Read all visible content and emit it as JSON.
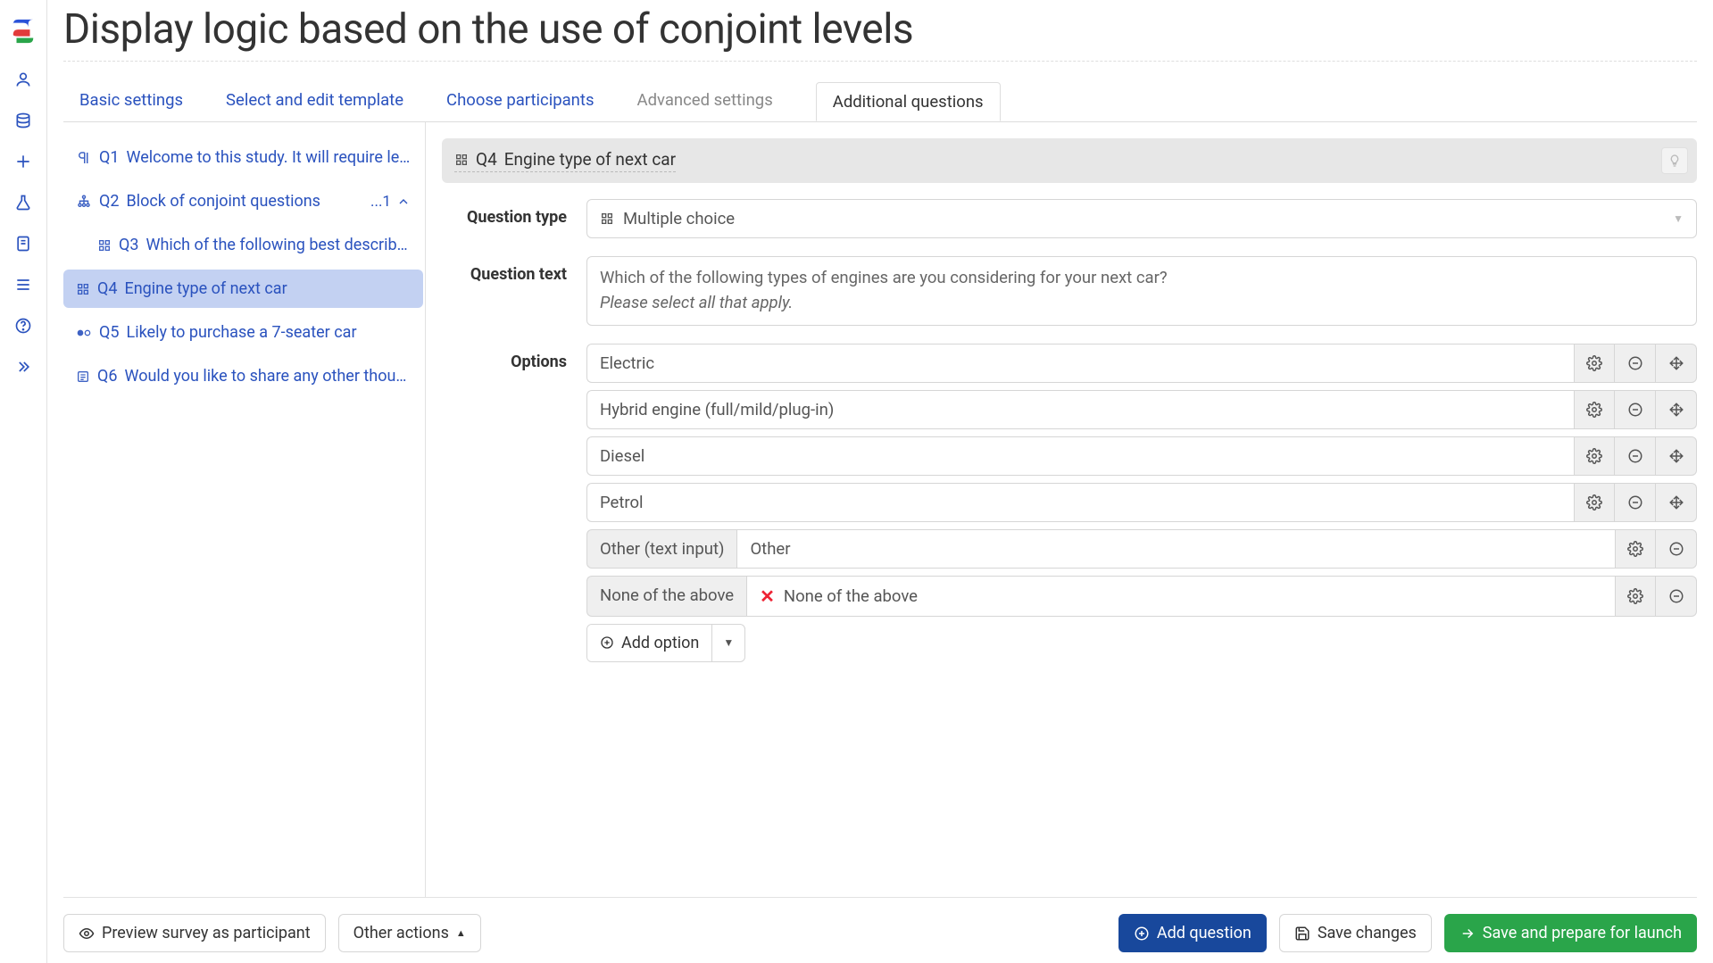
{
  "page_title": "Display logic based on the use of conjoint levels",
  "tabs": [
    {
      "label": "Basic settings",
      "state": "link"
    },
    {
      "label": "Select and edit template",
      "state": "link"
    },
    {
      "label": "Choose participants",
      "state": "link"
    },
    {
      "label": "Advanced settings",
      "state": "disabled"
    },
    {
      "label": "Additional questions",
      "state": "active"
    }
  ],
  "questions": [
    {
      "num": "Q1",
      "label": "Welcome to this study. It will require less t…",
      "icon": "paragraph",
      "child": false,
      "selected": false,
      "tail": ""
    },
    {
      "num": "Q2",
      "label": "Block of conjoint questions",
      "icon": "hierarchy",
      "child": false,
      "selected": false,
      "tail": "...1",
      "chevron": true
    },
    {
      "num": "Q3",
      "label": "Which of the following best describes …",
      "icon": "grid",
      "child": true,
      "selected": false,
      "tail": ""
    },
    {
      "num": "Q4",
      "label": "Engine type of next car",
      "icon": "grid",
      "child": false,
      "selected": true,
      "tail": ""
    },
    {
      "num": "Q5",
      "label": "Likely to purchase a 7-seater car",
      "icon": "radio",
      "child": false,
      "selected": false,
      "tail": ""
    },
    {
      "num": "Q6",
      "label": "Would you like to share any other thought…",
      "icon": "note",
      "child": false,
      "selected": false,
      "tail": ""
    }
  ],
  "current": {
    "num": "Q4",
    "title": "Engine type of next car",
    "type_label_prefix": "Question type",
    "type_value": "Multiple choice",
    "text_label": "Question text",
    "text_line1": "Which of the following types of engines are you considering for your next car?",
    "text_line2": "Please select all that apply.",
    "options_label": "Options",
    "options": [
      {
        "kind": "text",
        "value": "Electric"
      },
      {
        "kind": "text",
        "value": "Hybrid engine (full/mild/plug-in)"
      },
      {
        "kind": "text",
        "value": "Diesel"
      },
      {
        "kind": "text",
        "value": "Petrol"
      },
      {
        "kind": "other",
        "prefix": "Other (text input)",
        "value": "Other"
      },
      {
        "kind": "none",
        "prefix": "None of the above",
        "value": "None of the above"
      }
    ],
    "add_option_label": "Add option"
  },
  "footer": {
    "preview": "Preview survey as participant",
    "other_actions": "Other actions",
    "add_question": "Add question",
    "save_changes": "Save changes",
    "save_launch": "Save and prepare for launch"
  }
}
